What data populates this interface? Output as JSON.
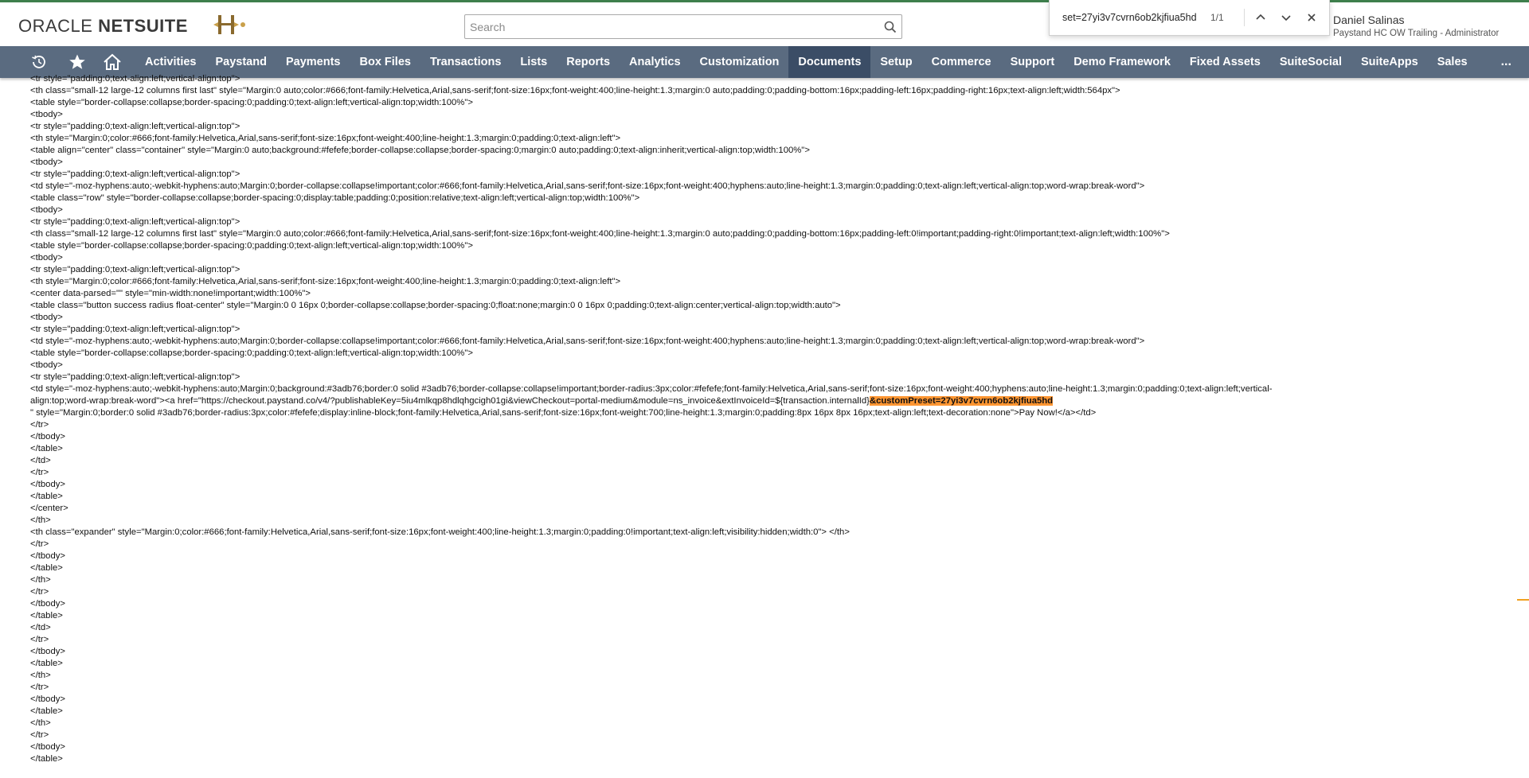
{
  "header": {
    "logo": {
      "part1": "ORACLE ",
      "part2": "NETSUITE"
    },
    "search": {
      "placeholder": "Search"
    },
    "user": {
      "name": "Daniel Salinas",
      "role": "Paystand HC OW Trailing - Administrator"
    }
  },
  "findbar": {
    "query": "set=27yi3v7cvrn6ob2kjfiua5hd",
    "count": "1/1"
  },
  "nav": {
    "icons": [
      "recent-icon",
      "star-icon",
      "home-icon"
    ],
    "items": [
      {
        "label": "Activities",
        "active": false
      },
      {
        "label": "Paystand",
        "active": false
      },
      {
        "label": "Payments",
        "active": false
      },
      {
        "label": "Box Files",
        "active": false
      },
      {
        "label": "Transactions",
        "active": false
      },
      {
        "label": "Lists",
        "active": false
      },
      {
        "label": "Reports",
        "active": false
      },
      {
        "label": "Analytics",
        "active": false
      },
      {
        "label": "Customization",
        "active": false
      },
      {
        "label": "Documents",
        "active": true
      },
      {
        "label": "Setup",
        "active": false
      },
      {
        "label": "Commerce",
        "active": false
      },
      {
        "label": "Support",
        "active": false
      },
      {
        "label": "Demo Framework",
        "active": false
      },
      {
        "label": "Fixed Assets",
        "active": false
      },
      {
        "label": "SuiteSocial",
        "active": false
      },
      {
        "label": "SuiteApps",
        "active": false
      },
      {
        "label": "Sales",
        "active": false
      }
    ],
    "more": "..."
  },
  "code": {
    "lines": [
      "<tr style=\"padding:0;text-align:left;vertical-align:top\">",
      "<th class=\"small-12 large-12 columns first last\" style=\"Margin:0 auto;color:#666;font-family:Helvetica,Arial,sans-serif;font-size:16px;font-weight:400;line-height:1.3;margin:0 auto;padding:0;padding-bottom:16px;padding-left:16px;padding-right:16px;text-align:left;width:564px\">",
      "<table style=\"border-collapse:collapse;border-spacing:0;padding:0;text-align:left;vertical-align:top;width:100%\">",
      "<tbody>",
      "<tr style=\"padding:0;text-align:left;vertical-align:top\">",
      "<th style=\"Margin:0;color:#666;font-family:Helvetica,Arial,sans-serif;font-size:16px;font-weight:400;line-height:1.3;margin:0;padding:0;text-align:left\">",
      "<table align=\"center\" class=\"container\" style=\"Margin:0 auto;background:#fefefe;border-collapse:collapse;border-spacing:0;margin:0 auto;padding:0;text-align:inherit;vertical-align:top;width:100%\">",
      "<tbody>",
      "<tr style=\"padding:0;text-align:left;vertical-align:top\">",
      "<td style=\"-moz-hyphens:auto;-webkit-hyphens:auto;Margin:0;border-collapse:collapse!important;color:#666;font-family:Helvetica,Arial,sans-serif;font-size:16px;font-weight:400;hyphens:auto;line-height:1.3;margin:0;padding:0;text-align:left;vertical-align:top;word-wrap:break-word\">",
      "<table class=\"row\" style=\"border-collapse:collapse;border-spacing:0;display:table;padding:0;position:relative;text-align:left;vertical-align:top;width:100%\">",
      "<tbody>",
      "<tr style=\"padding:0;text-align:left;vertical-align:top\">",
      "<th class=\"small-12 large-12 columns first last\" style=\"Margin:0 auto;color:#666;font-family:Helvetica,Arial,sans-serif;font-size:16px;font-weight:400;line-height:1.3;margin:0 auto;padding:0;padding-bottom:16px;padding-left:0!important;padding-right:0!important;text-align:left;width:100%\">",
      "<table style=\"border-collapse:collapse;border-spacing:0;padding:0;text-align:left;vertical-align:top;width:100%\">",
      "<tbody>",
      "<tr style=\"padding:0;text-align:left;vertical-align:top\">",
      "<th style=\"Margin:0;color:#666;font-family:Helvetica,Arial,sans-serif;font-size:16px;font-weight:400;line-height:1.3;margin:0;padding:0;text-align:left\">",
      "<center data-parsed=\"\" style=\"min-width:none!important;width:100%\">",
      "<table class=\"button success radius float-center\" style=\"Margin:0 0 16px 0;border-collapse:collapse;border-spacing:0;float:none;margin:0 0 16px 0;padding:0;text-align:center;vertical-align:top;width:auto\">",
      "<tbody>",
      "<tr style=\"padding:0;text-align:left;vertical-align:top\">",
      "<td style=\"-moz-hyphens:auto;-webkit-hyphens:auto;Margin:0;border-collapse:collapse!important;color:#666;font-family:Helvetica,Arial,sans-serif;font-size:16px;font-weight:400;hyphens:auto;line-height:1.3;margin:0;padding:0;text-align:left;vertical-align:top;word-wrap:break-word\">",
      "<table style=\"border-collapse:collapse;border-spacing:0;padding:0;text-align:left;vertical-align:top;width:100%\">",
      "<tbody>",
      "<tr style=\"padding:0;text-align:left;vertical-align:top\">",
      "<td style=\"-moz-hyphens:auto;-webkit-hyphens:auto;Margin:0;background:#3adb76;border:0 solid #3adb76;border-collapse:collapse!important;border-radius:3px;color:#fefefe;font-family:Helvetica,Arial,sans-serif;font-size:16px;font-weight:400;hyphens:auto;line-height:1.3;margin:0;padding:0;text-align:left;vertical-"
    ],
    "wrap_line_prefix": "align:top;word-wrap:break-word\"><a href=\"https://checkout.paystand.co/v4/?publishableKey=5iu4mlkqp8hdlqhgcigh01gi&viewCheckout=portal-medium&module=ns_invoice&extInvoiceId=${transaction.internalId}",
    "highlight": "&customPreset=27yi3v7cvrn6ob2kjfiua5hd",
    "after_highlight_line": "\" style=\"Margin:0;border:0 solid #3adb76;border-radius:3px;color:#fefefe;display:inline-block;font-family:Helvetica,Arial,sans-serif;font-size:16px;font-weight:700;line-height:1.3;margin:0;padding:8px 16px 8px 16px;text-align:left;text-decoration:none\">Pay Now!</a></td>",
    "tail_lines": [
      "</tr>",
      "</tbody>",
      "</table>",
      "</td>",
      "</tr>",
      "</tbody>",
      "</table>",
      "</center>",
      "</th>",
      "<th class=\"expander\" style=\"Margin:0;color:#666;font-family:Helvetica,Arial,sans-serif;font-size:16px;font-weight:400;line-height:1.3;margin:0;padding:0!important;text-align:left;visibility:hidden;width:0\"> </th>",
      "</tr>",
      "</tbody>",
      "</table>",
      "</th>",
      "</tr>",
      "</tbody>",
      "</table>",
      "</td>",
      "</tr>",
      "</tbody>",
      "</table>",
      "</th>",
      "</tr>",
      "</tbody>",
      "</table>",
      "</th>",
      "</tr>",
      "</tbody>",
      "</table>"
    ]
  }
}
